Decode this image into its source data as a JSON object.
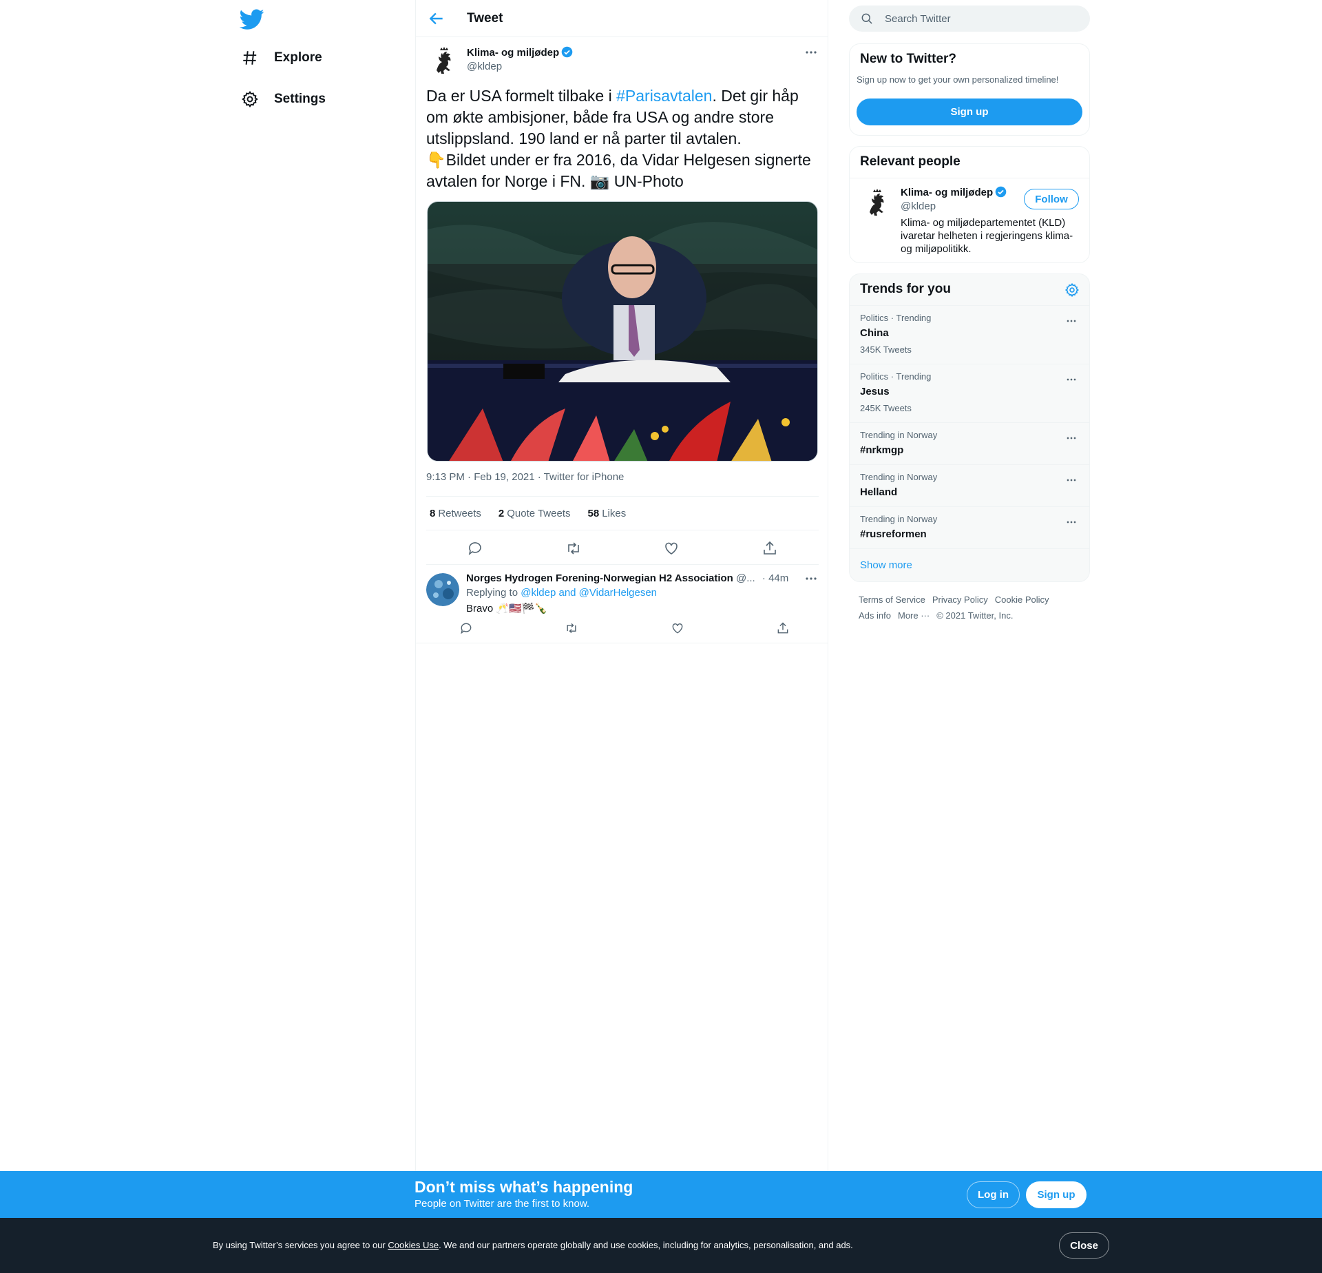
{
  "nav": {
    "explore_label": "Explore",
    "settings_label": "Settings"
  },
  "header": {
    "title": "Tweet"
  },
  "tweet": {
    "author_name": "Klima- og miljødep",
    "author_handle": "@kldep",
    "text_part1": "Da er USA formelt tilbake i ",
    "hashtag": "#Parisavtalen",
    "text_part2": ". Det gir håp om økte ambisjoner, både fra USA og andre store utslippsland. 190 land er nå parter til avtalen.",
    "text_line2_emoji": "👇",
    "text_line2": "Bildet under er fra 2016, da Vidar Helgesen signerte avtalen for Norge i FN. ",
    "camera_emoji": "📷",
    "text_line2_tail": " UN-Photo",
    "time": "9:13 PM · Feb 19, 2021 · Twitter for iPhone",
    "retweets_count": "8",
    "retweets_label": "Retweets",
    "quotes_count": "2",
    "quotes_label": "Quote Tweets",
    "likes_count": "58",
    "likes_label": "Likes"
  },
  "reply": {
    "author_name": "Norges Hydrogen Forening-Norwegian H2 Association",
    "author_handle_trunc": "@...",
    "time": "· 44m",
    "replying_prefix": "Replying to ",
    "replying_targets": "@kldep and @VidarHelgesen",
    "text": "Bravo 🥂🇺🇸🏁🍾"
  },
  "search": {
    "placeholder": "Search Twitter"
  },
  "new_to_twitter": {
    "title": "New to Twitter?",
    "subtitle": "Sign up now to get your own personalized timeline!",
    "button": "Sign up"
  },
  "relevant_people": {
    "title": "Relevant people",
    "name": "Klima- og miljødep",
    "handle": "@kldep",
    "follow": "Follow",
    "bio": "Klima- og miljødepartementet (KLD) ivaretar helheten i regjeringens klima- og miljøpolitikk."
  },
  "trends": {
    "title": "Trends for you",
    "items": [
      {
        "category": "Politics · Trending",
        "name": "China",
        "count": "345K Tweets"
      },
      {
        "category": "Politics · Trending",
        "name": "Jesus",
        "count": "245K Tweets"
      },
      {
        "category": "Trending in Norway",
        "name": "#nrkmgp",
        "count": ""
      },
      {
        "category": "Trending in Norway",
        "name": "Helland",
        "count": ""
      },
      {
        "category": "Trending in Norway",
        "name": "#rusreformen",
        "count": ""
      }
    ],
    "show_more": "Show more"
  },
  "footer": {
    "links": [
      "Terms of Service",
      "Privacy Policy",
      "Cookie Policy"
    ],
    "ads": "Ads info",
    "more": "More ···",
    "copyright": "© 2021 Twitter, Inc."
  },
  "signup_bar": {
    "headline": "Don’t miss what’s happening",
    "sub": "People on Twitter are the first to know.",
    "login": "Log in",
    "signup": "Sign up"
  },
  "cookie_bar": {
    "prefix": "By using Twitter’s services you agree to our ",
    "link": "Cookies Use",
    "suffix": ". We and our partners operate globally and use cookies, including for analytics, personalisation, and ads.",
    "close": "Close"
  },
  "colors": {
    "accent": "#1d9bf0",
    "text": "#0f1419",
    "secondary": "#536471",
    "cookie_bg": "#15202b"
  }
}
